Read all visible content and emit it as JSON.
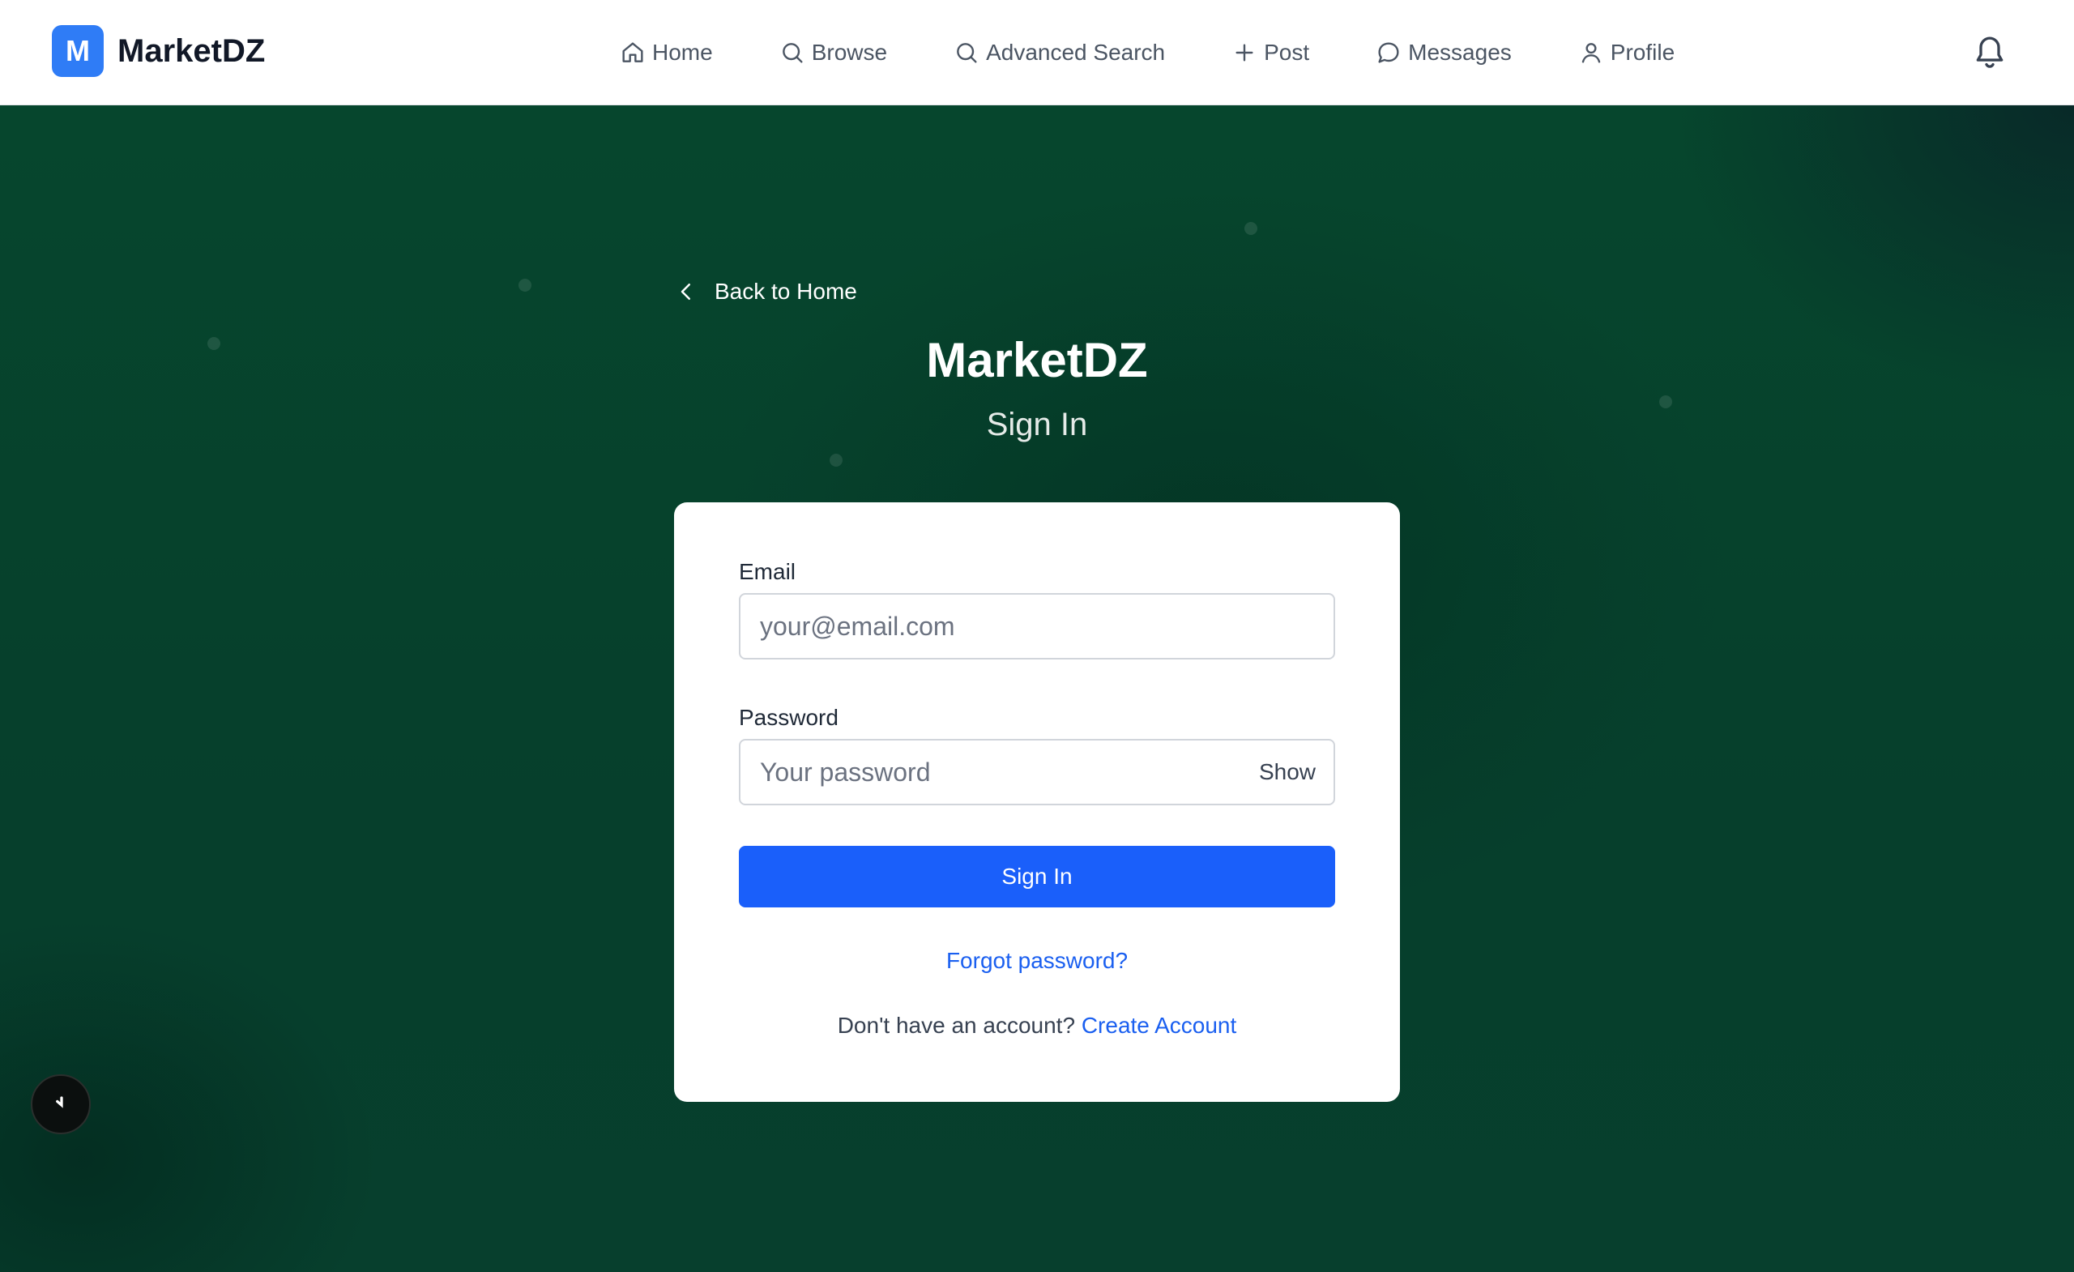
{
  "brand": {
    "logo_letter": "M",
    "name": "MarketDZ",
    "color": "#2f7cf6"
  },
  "nav": {
    "items": [
      {
        "label": "Home",
        "icon": "home-icon"
      },
      {
        "label": "Browse",
        "icon": "search-icon"
      },
      {
        "label": "Advanced Search",
        "icon": "search-icon"
      },
      {
        "label": "Post",
        "icon": "plus-icon"
      },
      {
        "label": "Messages",
        "icon": "message-icon"
      },
      {
        "label": "Profile",
        "icon": "user-icon"
      }
    ],
    "notifications_icon": "bell-icon"
  },
  "page": {
    "back_label": "Back to Home",
    "title": "MarketDZ",
    "subtitle": "Sign In",
    "background_color": "#06402b"
  },
  "form": {
    "email_label": "Email",
    "email_placeholder": "your@email.com",
    "email_value": "",
    "password_label": "Password",
    "password_placeholder": "Your password",
    "password_value": "",
    "show_label": "Show",
    "submit_label": "Sign In",
    "submit_color": "#1a5ffa",
    "forgot_label": "Forgot password?",
    "signup_prompt": "Don't have an account?",
    "signup_link": "Create Account"
  },
  "floating_button_icon": "loading-icon"
}
